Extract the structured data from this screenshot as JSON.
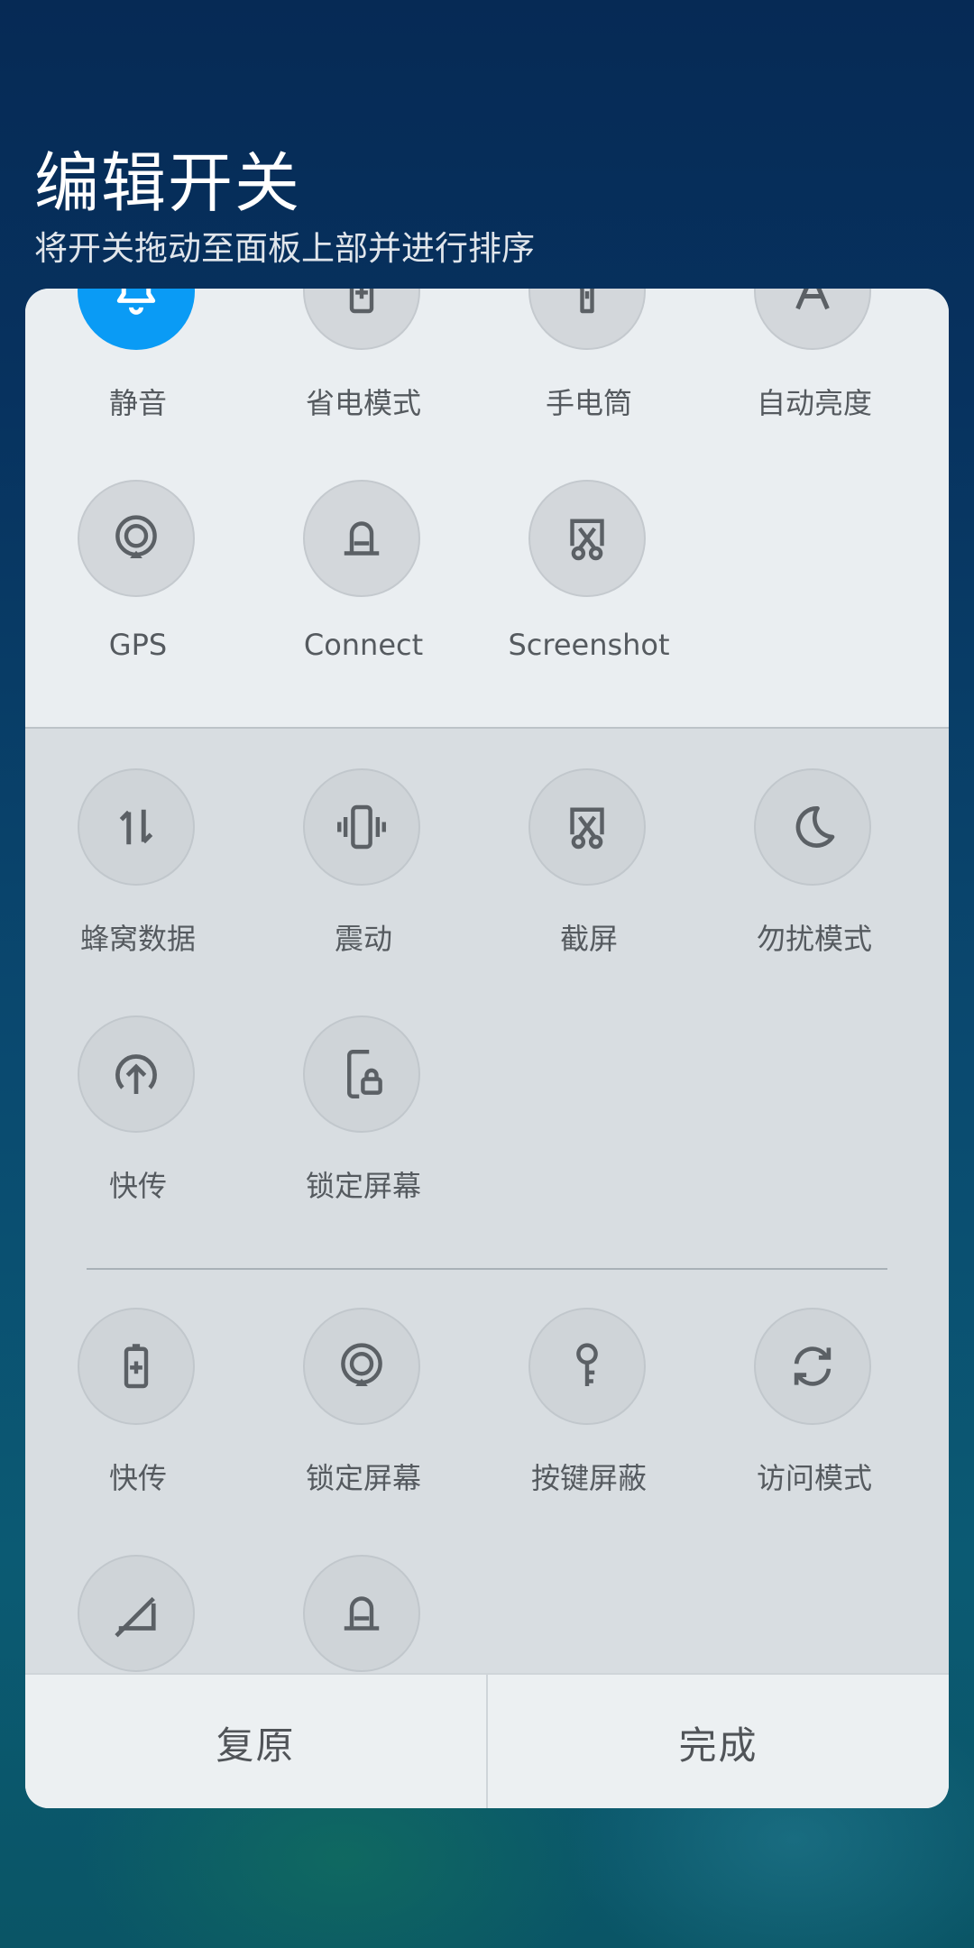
{
  "header": {
    "title": "编辑开关",
    "subtitle": "将开关拖动至面板上部并进行排序"
  },
  "active_tiles": [
    {
      "label": "静音",
      "icon": "bell-icon",
      "active": true
    },
    {
      "label": "省电模式",
      "icon": "battery-saver-icon",
      "active": false
    },
    {
      "label": "手电筒",
      "icon": "flashlight-icon",
      "active": false
    },
    {
      "label": "自动亮度",
      "icon": "auto-brightness-icon",
      "active": false
    },
    {
      "label": "GPS",
      "icon": "location-icon",
      "active": false
    },
    {
      "label": "Connect",
      "icon": "connect-icon",
      "active": false
    },
    {
      "label": "Screenshot",
      "icon": "screenshot-icon",
      "active": false
    }
  ],
  "available_tiles": [
    {
      "label": "蜂窝数据",
      "icon": "mobile-data-icon"
    },
    {
      "label": "震动",
      "icon": "vibrate-icon"
    },
    {
      "label": "截屏",
      "icon": "screenshot-icon"
    },
    {
      "label": "勿扰模式",
      "icon": "moon-icon"
    },
    {
      "label": "快传",
      "icon": "upload-icon"
    },
    {
      "label": "锁定屏幕",
      "icon": "lock-screen-icon"
    }
  ],
  "more_tiles": [
    {
      "label": "快传",
      "icon": "battery-saver-icon"
    },
    {
      "label": "锁定屏幕",
      "icon": "location-icon"
    },
    {
      "label": "按键屏蔽",
      "icon": "key-icon"
    },
    {
      "label": "访问模式",
      "icon": "sync-icon"
    },
    {
      "label": "",
      "icon": "no-signal-icon"
    },
    {
      "label": "",
      "icon": "connect-icon"
    }
  ],
  "bottom_bar": {
    "reset_label": "复原",
    "done_label": "完成"
  },
  "colors": {
    "accent": "#0a9bf5"
  }
}
